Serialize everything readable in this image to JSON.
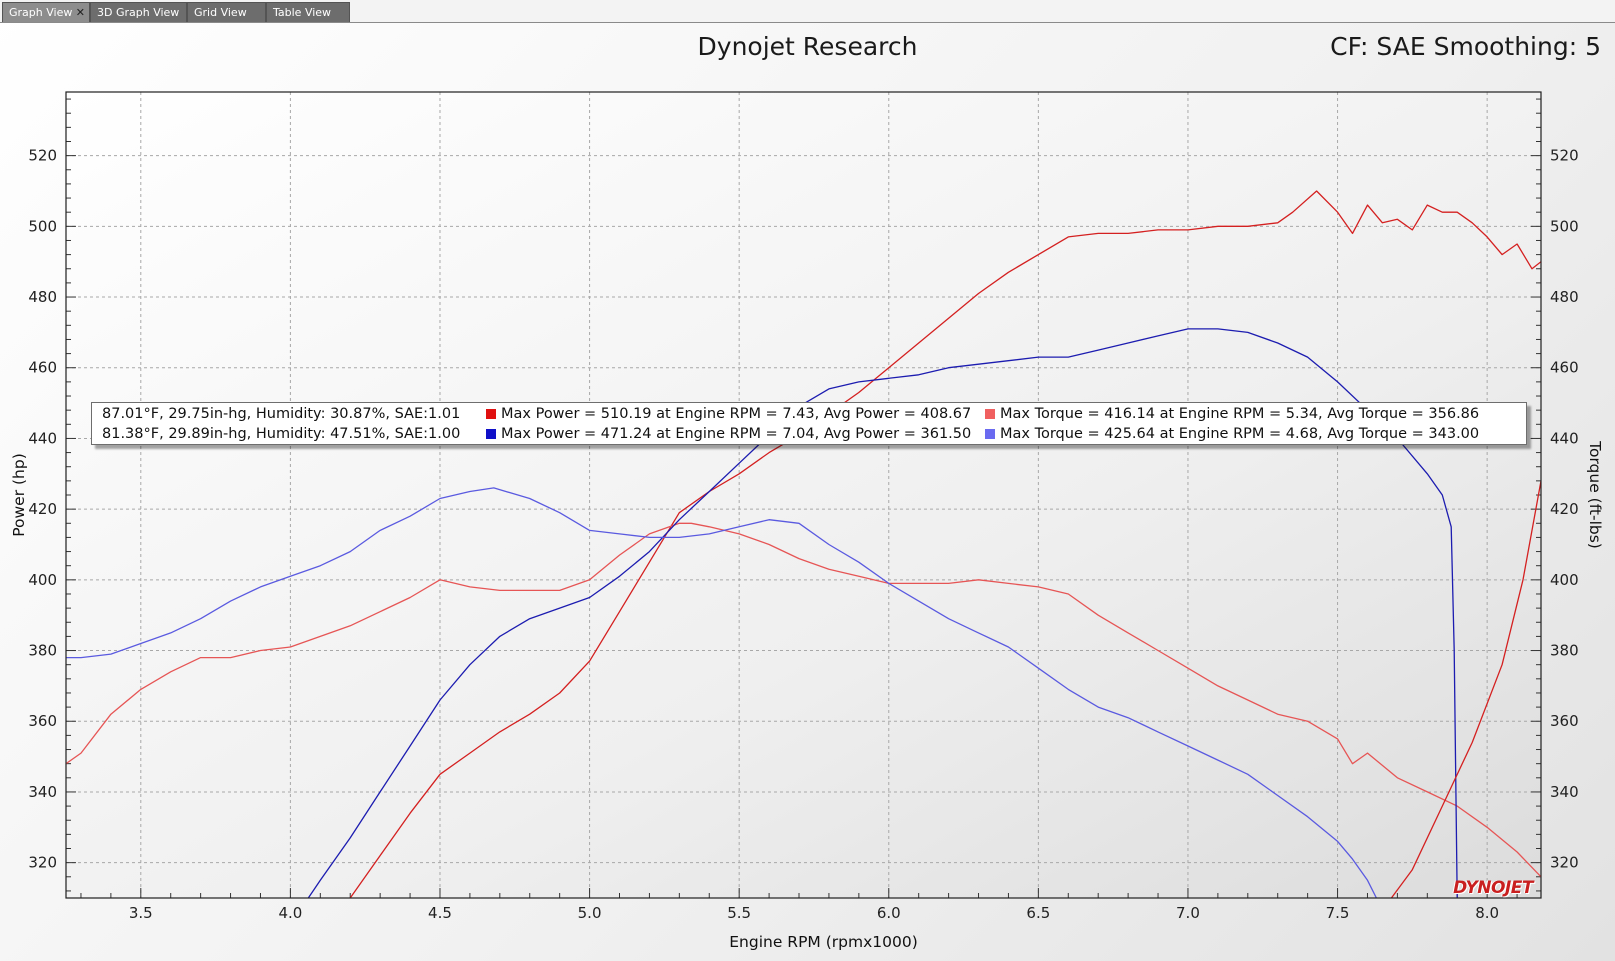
{
  "tabs": [
    {
      "label": "Graph View",
      "active": true,
      "close": "✕"
    },
    {
      "label": "3D Graph View",
      "active": false
    },
    {
      "label": "Grid View",
      "active": false
    },
    {
      "label": "Table View",
      "active": false
    }
  ],
  "header": {
    "title": "Dynojet Research",
    "cf": "CF: SAE Smoothing: 5"
  },
  "logo": "DYNOJET",
  "legend": {
    "rows": [
      {
        "conditions": "87.01°F, 29.75in-hg, Humidity: 30.87%, SAE:1.01",
        "power_color": "#e01010",
        "power_text": "Max Power = 510.19 at Engine RPM = 7.43,  Avg Power = 408.67",
        "torque_color": "#f06060",
        "torque_text": "Max Torque = 416.14 at Engine RPM = 5.34,  Avg Torque = 356.86"
      },
      {
        "conditions": "81.38°F, 29.89in-hg, Humidity: 47.51%, SAE:1.00",
        "power_color": "#1010c8",
        "power_text": "Max Power = 471.24 at Engine RPM = 7.04,  Avg Power = 361.50",
        "torque_color": "#6a6af0",
        "torque_text": "Max Torque = 425.64 at Engine RPM = 4.68,  Avg Torque = 343.00"
      }
    ]
  },
  "chart_data": {
    "type": "line",
    "xlabel": "Engine RPM (rpmx1000)",
    "ylabel": "Power (hp)",
    "y2label": "Torque (ft-lbs)",
    "xlim": [
      3.25,
      8.18
    ],
    "ylim": [
      310,
      538
    ],
    "y2lim": [
      310,
      538
    ],
    "xticks": [
      "3.5",
      "4.0",
      "4.5",
      "5.0",
      "5.5",
      "6.0",
      "6.5",
      "7.0",
      "7.5",
      "8.0"
    ],
    "yticks": [
      "320",
      "340",
      "360",
      "380",
      "400",
      "420",
      "440",
      "460",
      "480",
      "500",
      "520"
    ],
    "grid": true,
    "series": [
      {
        "axis": "left",
        "color": "#d42020",
        "points": [
          [
            4.2,
            310
          ],
          [
            4.3,
            322
          ],
          [
            4.4,
            334
          ],
          [
            4.5,
            345
          ],
          [
            4.6,
            351
          ],
          [
            4.7,
            357
          ],
          [
            4.8,
            362
          ],
          [
            4.9,
            368
          ],
          [
            5.0,
            377
          ],
          [
            5.1,
            391
          ],
          [
            5.2,
            405
          ],
          [
            5.3,
            419
          ],
          [
            5.4,
            425
          ],
          [
            5.5,
            430
          ],
          [
            5.6,
            436
          ],
          [
            5.7,
            441
          ],
          [
            5.8,
            447
          ],
          [
            5.9,
            453
          ],
          [
            6.0,
            460
          ],
          [
            6.1,
            467
          ],
          [
            6.2,
            474
          ],
          [
            6.3,
            481
          ],
          [
            6.4,
            487
          ],
          [
            6.5,
            492
          ],
          [
            6.6,
            497
          ],
          [
            6.7,
            498
          ],
          [
            6.8,
            498
          ],
          [
            6.9,
            499
          ],
          [
            7.0,
            499
          ],
          [
            7.1,
            500
          ],
          [
            7.2,
            500
          ],
          [
            7.3,
            501
          ],
          [
            7.35,
            504
          ],
          [
            7.43,
            510
          ],
          [
            7.5,
            504
          ],
          [
            7.55,
            498
          ],
          [
            7.6,
            506
          ],
          [
            7.65,
            501
          ],
          [
            7.7,
            502
          ],
          [
            7.75,
            499
          ],
          [
            7.8,
            506
          ],
          [
            7.85,
            504
          ],
          [
            7.9,
            504
          ],
          [
            7.95,
            501
          ],
          [
            8.0,
            497
          ],
          [
            8.05,
            492
          ],
          [
            8.1,
            495
          ],
          [
            8.15,
            488
          ],
          [
            8.18,
            490
          ]
        ]
      },
      {
        "axis": "right",
        "color": "#e65555",
        "points": [
          [
            3.25,
            348
          ],
          [
            3.3,
            351
          ],
          [
            3.4,
            362
          ],
          [
            3.5,
            369
          ],
          [
            3.6,
            374
          ],
          [
            3.7,
            378
          ],
          [
            3.8,
            378
          ],
          [
            3.9,
            380
          ],
          [
            4.0,
            381
          ],
          [
            4.1,
            384
          ],
          [
            4.2,
            387
          ],
          [
            4.3,
            391
          ],
          [
            4.4,
            395
          ],
          [
            4.5,
            400
          ],
          [
            4.6,
            398
          ],
          [
            4.7,
            397
          ],
          [
            4.8,
            397
          ],
          [
            4.9,
            397
          ],
          [
            5.0,
            400
          ],
          [
            5.1,
            407
          ],
          [
            5.2,
            413
          ],
          [
            5.3,
            416
          ],
          [
            5.34,
            416
          ],
          [
            5.4,
            415
          ],
          [
            5.5,
            413
          ],
          [
            5.6,
            410
          ],
          [
            5.7,
            406
          ],
          [
            5.8,
            403
          ],
          [
            5.9,
            401
          ],
          [
            6.0,
            399
          ],
          [
            6.1,
            399
          ],
          [
            6.2,
            399
          ],
          [
            6.3,
            400
          ],
          [
            6.4,
            399
          ],
          [
            6.5,
            398
          ],
          [
            6.6,
            396
          ],
          [
            6.7,
            390
          ],
          [
            6.8,
            385
          ],
          [
            6.9,
            380
          ],
          [
            7.0,
            375
          ],
          [
            7.1,
            370
          ],
          [
            7.2,
            366
          ],
          [
            7.3,
            362
          ],
          [
            7.4,
            360
          ],
          [
            7.5,
            355
          ],
          [
            7.55,
            348
          ],
          [
            7.6,
            351
          ],
          [
            7.7,
            344
          ],
          [
            7.8,
            340
          ],
          [
            7.9,
            336
          ],
          [
            8.0,
            330
          ],
          [
            8.1,
            323
          ],
          [
            8.18,
            316
          ]
        ]
      },
      {
        "axis": "left",
        "color": "#1c1cb0",
        "points": [
          [
            4.06,
            310
          ],
          [
            4.1,
            315
          ],
          [
            4.2,
            327
          ],
          [
            4.3,
            340
          ],
          [
            4.4,
            353
          ],
          [
            4.5,
            366
          ],
          [
            4.6,
            376
          ],
          [
            4.7,
            384
          ],
          [
            4.8,
            389
          ],
          [
            4.9,
            392
          ],
          [
            5.0,
            395
          ],
          [
            5.1,
            401
          ],
          [
            5.2,
            408
          ],
          [
            5.3,
            417
          ],
          [
            5.4,
            425
          ],
          [
            5.5,
            433
          ],
          [
            5.6,
            441
          ],
          [
            5.7,
            449
          ],
          [
            5.8,
            454
          ],
          [
            5.9,
            456
          ],
          [
            6.0,
            457
          ],
          [
            6.1,
            458
          ],
          [
            6.2,
            460
          ],
          [
            6.3,
            461
          ],
          [
            6.4,
            462
          ],
          [
            6.5,
            463
          ],
          [
            6.6,
            463
          ],
          [
            6.7,
            465
          ],
          [
            6.8,
            467
          ],
          [
            6.9,
            469
          ],
          [
            7.0,
            471
          ],
          [
            7.04,
            471
          ],
          [
            7.1,
            471
          ],
          [
            7.2,
            470
          ],
          [
            7.3,
            467
          ],
          [
            7.4,
            463
          ],
          [
            7.5,
            456
          ],
          [
            7.6,
            448
          ],
          [
            7.7,
            440
          ],
          [
            7.8,
            430
          ],
          [
            7.85,
            424
          ],
          [
            7.88,
            415
          ],
          [
            7.89,
            380
          ],
          [
            7.9,
            310
          ]
        ]
      },
      {
        "axis": "right",
        "color": "#5a5ae0",
        "points": [
          [
            3.25,
            378
          ],
          [
            3.3,
            378
          ],
          [
            3.4,
            379
          ],
          [
            3.5,
            382
          ],
          [
            3.6,
            385
          ],
          [
            3.7,
            389
          ],
          [
            3.8,
            394
          ],
          [
            3.9,
            398
          ],
          [
            4.0,
            401
          ],
          [
            4.1,
            404
          ],
          [
            4.2,
            408
          ],
          [
            4.3,
            414
          ],
          [
            4.4,
            418
          ],
          [
            4.5,
            423
          ],
          [
            4.6,
            425
          ],
          [
            4.68,
            426
          ],
          [
            4.8,
            423
          ],
          [
            4.9,
            419
          ],
          [
            5.0,
            414
          ],
          [
            5.1,
            413
          ],
          [
            5.2,
            412
          ],
          [
            5.3,
            412
          ],
          [
            5.4,
            413
          ],
          [
            5.5,
            415
          ],
          [
            5.6,
            417
          ],
          [
            5.7,
            416
          ],
          [
            5.8,
            410
          ],
          [
            5.9,
            405
          ],
          [
            6.0,
            399
          ],
          [
            6.1,
            394
          ],
          [
            6.2,
            389
          ],
          [
            6.3,
            385
          ],
          [
            6.4,
            381
          ],
          [
            6.5,
            375
          ],
          [
            6.6,
            369
          ],
          [
            6.7,
            364
          ],
          [
            6.8,
            361
          ],
          [
            6.9,
            357
          ],
          [
            7.0,
            353
          ],
          [
            7.1,
            349
          ],
          [
            7.2,
            345
          ],
          [
            7.3,
            339
          ],
          [
            7.4,
            333
          ],
          [
            7.5,
            326
          ],
          [
            7.55,
            321
          ],
          [
            7.6,
            315
          ],
          [
            7.63,
            310
          ]
        ]
      },
      {
        "axis": "right",
        "color": "#d42020",
        "points": [
          [
            7.68,
            310
          ],
          [
            7.75,
            318
          ],
          [
            7.85,
            336
          ],
          [
            7.95,
            354
          ],
          [
            8.05,
            376
          ],
          [
            8.12,
            400
          ],
          [
            8.18,
            428
          ]
        ]
      }
    ]
  }
}
